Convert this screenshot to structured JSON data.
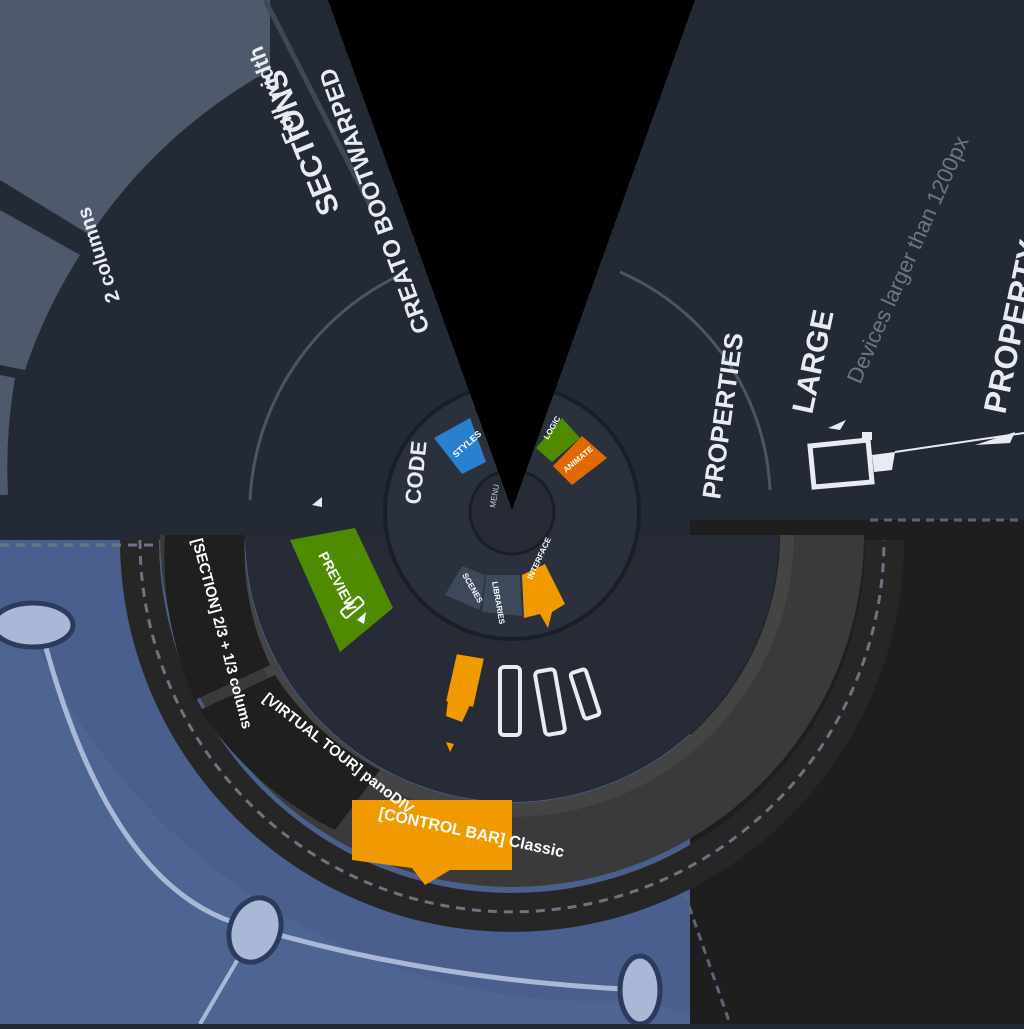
{
  "sections_panel": {
    "heading": "SECTIONS",
    "full_width": "Full width",
    "two_columns": "2 columns"
  },
  "app": {
    "brand": "CREATO BOOTWARPED"
  },
  "properties_panel": {
    "heading": "PROPERTIES",
    "size": "LARGE",
    "size_hint": "Devices larger than 1200px",
    "property_label": "PROPERTY"
  },
  "center_tools": {
    "left_label": "STYLES",
    "right_a": "LOGIC",
    "right_b": "ANIMATE",
    "bottom_a": "SCENES",
    "bottom_b": "LIBRARIES",
    "bottom_c": "INTERFACE",
    "code_label": "CODE",
    "hub_label": "MENU"
  },
  "preview": {
    "label": "PREVIEW"
  },
  "layers": [
    {
      "label": "[SECTION] 2/3 + 1/3 colums"
    },
    {
      "label": "[VIRTUAL TOUR] panoDIV"
    },
    {
      "label": "[CONTROL BAR] Classic"
    }
  ],
  "colors": {
    "orange": "#f09a00",
    "green": "#4f8b00",
    "blue": "#2a7fcf",
    "dark_orange": "#e06a00",
    "panel": "#232a36",
    "map_blue": "#4a5f8e"
  },
  "icons": [
    "pencil-icon",
    "phone-icon",
    "tablet-icon",
    "monitor-icon"
  ]
}
